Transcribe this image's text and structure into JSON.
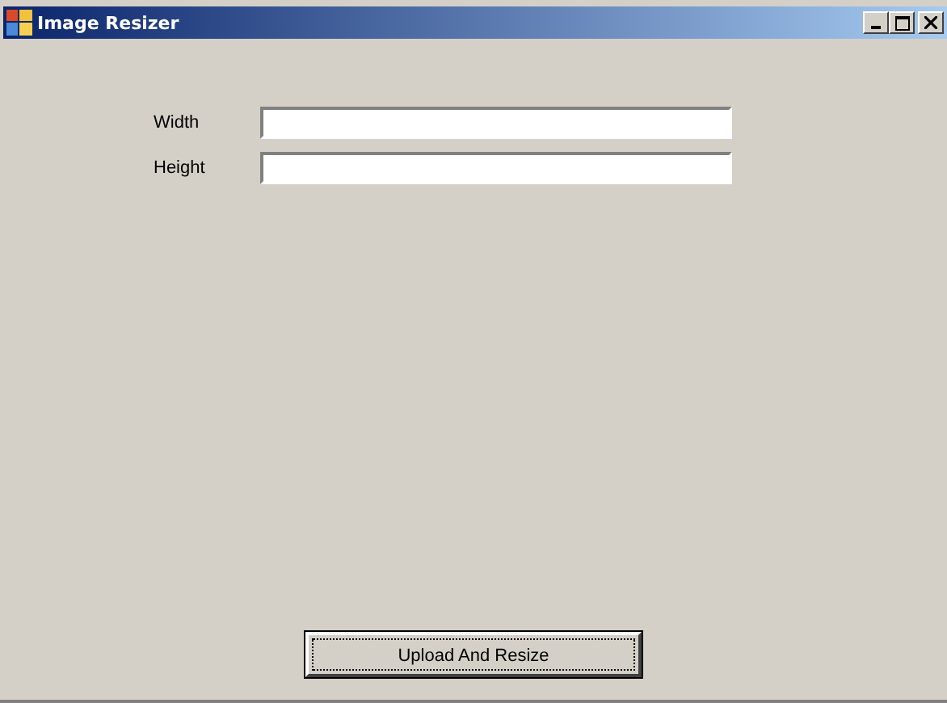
{
  "window": {
    "title": "Image Resizer"
  },
  "fields": [
    {
      "label": "Width"
    },
    {
      "label": "Height"
    }
  ],
  "button": {
    "label": "Upload And Resize"
  }
}
